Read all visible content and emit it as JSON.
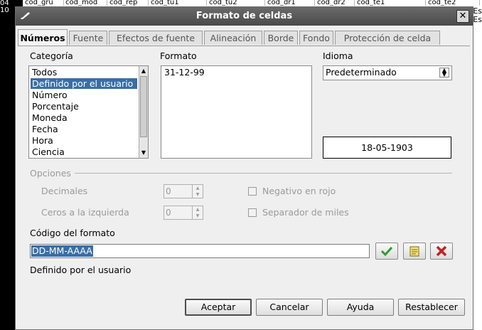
{
  "sheet": {
    "row_headers": [
      "04",
      "10"
    ],
    "column_headers": [
      "cod_gru",
      "cod_mod",
      "cod_rep",
      "cod_tu1",
      "cod_tu2",
      "cod_dr1",
      "cod_dr2",
      "cod_te1",
      "cod_te2"
    ],
    "right_fragments": [
      "Es",
      "Es"
    ]
  },
  "dialog": {
    "title": "Formato de celdas",
    "tabs": [
      "Números",
      "Fuente",
      "Efectos de fuente",
      "Alineación",
      "Borde",
      "Fondo",
      "Protección de celda"
    ],
    "active_tab": "Números",
    "category_label": "Categoría",
    "categories": [
      "Todos",
      "Definido por el usuario",
      "Número",
      "Porcentaje",
      "Moneda",
      "Fecha",
      "Hora",
      "Ciencia"
    ],
    "selected_category": "Definido por el usuario",
    "format_label": "Formato",
    "formats": [
      "31-12-99"
    ],
    "language_label": "Idioma",
    "language_value": "Predeterminado",
    "preview_value": "18-05-1903",
    "options_label": "Opciones",
    "decimals_label": "Decimales",
    "decimals_value": "0",
    "leading_zeros_label": "Ceros a la izquierda",
    "leading_zeros_value": "0",
    "negative_red_label": "Negativo en rojo",
    "thousands_sep_label": "Separador de miles",
    "format_code_label": "Código del formato",
    "format_code_value": "DD-MM-AAAA",
    "format_description": "Definido por el usuario",
    "buttons": {
      "accept": "Aceptar",
      "cancel": "Cancelar",
      "help": "Ayuda",
      "reset": "Restablecer"
    },
    "colors": {
      "selection": "#3a6ea5",
      "titlebar": "#5a5a5a",
      "check_green": "#2f9a2f",
      "delete_red": "#c42020"
    }
  }
}
